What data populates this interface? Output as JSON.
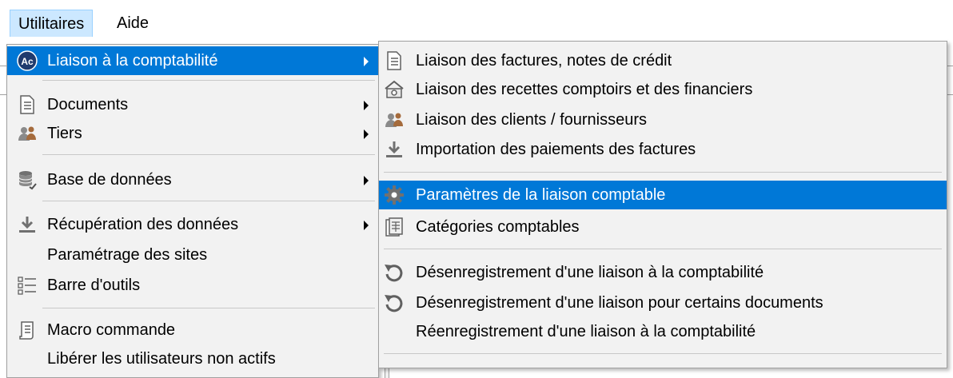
{
  "menubar": {
    "utilitaires": "Utilitaires",
    "aide": "Aide"
  },
  "utilitaires_menu": {
    "liaison_compta": "Liaison à la comptabilité",
    "documents": "Documents",
    "tiers": "Tiers",
    "base_donnees": "Base de données",
    "recuperation": "Récupération des données",
    "parametrage_sites": "Paramétrage des sites",
    "barre_outils": "Barre d'outils",
    "macro": "Macro commande",
    "liberer": "Libérer les utilisateurs non actifs",
    "ac_badge": "Ac"
  },
  "liaison_submenu": {
    "factures": "Liaison des factures, notes de crédit",
    "recettes": "Liaison des recettes comptoirs et des financiers",
    "clients": "Liaison des clients / fournisseurs",
    "import_paiements": "Importation des paiements des factures",
    "parametres": "Paramètres de la liaison comptable",
    "categories": "Catégories comptables",
    "desenreg_liaison": "Désenregistrement d'une liaison à la comptabilité",
    "desenreg_docs": "Désenregistrement d'une liaison pour certains documents",
    "reenreg": "Réenregistrement d'une liaison à la comptabilité"
  },
  "colors": {
    "highlight": "#0078d7",
    "menubar_open": "#cce8ff",
    "menu_bg": "#f2f2f2"
  }
}
